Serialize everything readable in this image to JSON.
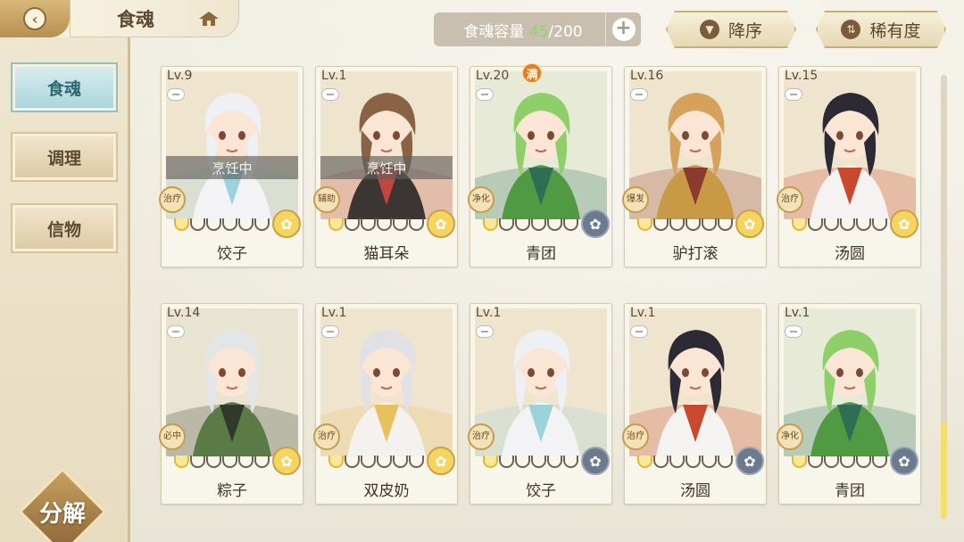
{
  "header": {
    "title": "食魂",
    "capacity_prefix": "食魂容量 ",
    "capacity_current": "45",
    "capacity_suffix": "/200",
    "sort_order_label": "降序",
    "sort_rarity_label": "稀有度"
  },
  "sidebar": {
    "items": [
      {
        "label": "食魂",
        "active": true
      },
      {
        "label": "调理",
        "active": false
      },
      {
        "label": "信物",
        "active": false
      }
    ],
    "decompose_label": "分解"
  },
  "cards": [
    {
      "level": "Lv.9",
      "name": "饺子",
      "status": "烹饪中",
      "role": "治疗",
      "stars": 1,
      "element": "gold",
      "full": false,
      "hair": "#eef0f3",
      "outfit": "#f3f3f6",
      "accent": "#9ad3d9",
      "bg": "#efe5cf"
    },
    {
      "level": "Lv.1",
      "name": "猫耳朵",
      "status": "烹饪中",
      "role": "辅助",
      "stars": 1,
      "element": "gold",
      "full": false,
      "hair": "#8a6244",
      "outfit": "#3b3634",
      "accent": "#c2463c",
      "bg": "#efe5cf"
    },
    {
      "level": "Lv.20",
      "name": "青团",
      "status": "",
      "role": "净化",
      "stars": 1,
      "element": "dark",
      "full": true,
      "full_label": "满",
      "hair": "#8fcf6a",
      "outfit": "#4f9a43",
      "accent": "#2d6e54",
      "bg": "#e6ead7"
    },
    {
      "level": "Lv.16",
      "name": "驴打滚",
      "status": "",
      "role": "爆发",
      "stars": 1,
      "element": "gold",
      "full": false,
      "hair": "#d6a15a",
      "outfit": "#c99a45",
      "accent": "#8b3b2b",
      "bg": "#efe5cf"
    },
    {
      "level": "Lv.15",
      "name": "汤圆",
      "status": "",
      "role": "治疗",
      "stars": 1,
      "element": "gold",
      "full": false,
      "hair": "#2c2a35",
      "outfit": "#f5f3f1",
      "accent": "#c9492e",
      "bg": "#efe5cf"
    },
    {
      "level": "Lv.14",
      "name": "粽子",
      "status": "",
      "role": "必中",
      "stars": 1,
      "element": "gold",
      "full": false,
      "hair": "#e3e6e6",
      "outfit": "#5a7b45",
      "accent": "#2f3a2a",
      "bg": "#e9e3d2"
    },
    {
      "level": "Lv.1",
      "name": "双皮奶",
      "status": "",
      "role": "治疗",
      "stars": 1,
      "element": "gold",
      "full": false,
      "hair": "#e0e0e6",
      "outfit": "#f4f1ee",
      "accent": "#e8c15e",
      "bg": "#efe5cf"
    },
    {
      "level": "Lv.1",
      "name": "饺子",
      "status": "",
      "role": "治疗",
      "stars": 1,
      "element": "dark",
      "full": false,
      "hair": "#eef0f3",
      "outfit": "#f3f3f6",
      "accent": "#9ad3d9",
      "bg": "#efe5cf"
    },
    {
      "level": "Lv.1",
      "name": "汤圆",
      "status": "",
      "role": "治疗",
      "stars": 1,
      "element": "dark",
      "full": false,
      "hair": "#2c2a35",
      "outfit": "#f5f3f1",
      "accent": "#c9492e",
      "bg": "#efe5cf"
    },
    {
      "level": "Lv.1",
      "name": "青团",
      "status": "",
      "role": "净化",
      "stars": 1,
      "element": "dark",
      "full": false,
      "hair": "#8fcf6a",
      "outfit": "#4f9a43",
      "accent": "#2d6e54",
      "bg": "#e6ead7"
    }
  ]
}
